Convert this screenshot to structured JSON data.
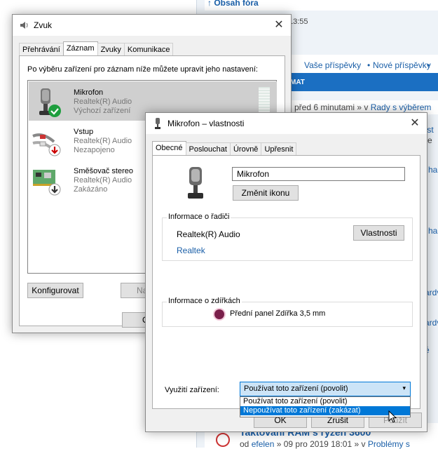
{
  "forum": {
    "header": "Obsah fóra",
    "time_fragment": "13:55",
    "link_posts": "Vaše příspěvky",
    "link_new": "Nové příspěvky",
    "bar_fragment": "MAT",
    "row1_time": "před 6 minutami » v ",
    "row1_link": "Rady s výběrem",
    "frag_1": "nist",
    "frag_2": "nte",
    "frag_3": "ha",
    "frag_4": "ha",
    "frag_5": "ardv",
    "frag_6": "ardv",
    "frag_7": "é",
    "post_title": "Taktování RAM s ryzen 3600",
    "post_meta_prefix": "od ",
    "post_author": "efelen",
    "post_meta_date": " » 09 pro 2019 18:01 » v ",
    "post_category": "Problémy s"
  },
  "sound": {
    "title": "Zvuk",
    "tabs": [
      "Přehrávání",
      "Záznam",
      "Zvuky",
      "Komunikace"
    ],
    "instruction": "Po výběru zařízení pro záznam níže můžete upravit jeho nastavení:",
    "devices": [
      {
        "name": "Mikrofon",
        "driver": "Realtek(R) Audio",
        "status": "Výchozí zařízení"
      },
      {
        "name": "Vstup",
        "driver": "Realtek(R) Audio",
        "status": "Nezapojeno"
      },
      {
        "name": "Směšovač stereo",
        "driver": "Realtek(R) Audio",
        "status": "Zakázáno"
      }
    ],
    "configure_label": "Konfigurovat",
    "default_partial": "Na",
    "ok_partial": "O"
  },
  "props": {
    "title": "Mikrofon – vlastnosti",
    "tabs": [
      "Obecné",
      "Poslouchat",
      "Úrovně",
      "Upřesnit"
    ],
    "name_value": "Mikrofon",
    "change_icon_label": "Změnit ikonu",
    "controller_group": "Informace o řadiči",
    "controller_name": "Realtek(R) Audio",
    "properties_label": "Vlastnosti",
    "controller_link": "Realtek",
    "jack_group": "Informace o zdířkách",
    "jack_name": "Přední panel Zdířka 3,5 mm",
    "usage_label": "Využití zařízení:",
    "usage_selected": "Používat toto zařízení (povolit)",
    "usage_options": [
      "Používat toto zařízení (povolit)",
      "Nepoužívat toto zařízení (zakázat)"
    ],
    "ok_label": "OK",
    "cancel_label": "Zrušit",
    "apply_label": "Použít"
  },
  "colors": {
    "accent": "#0078d7",
    "forum_blue": "#1b6fc2",
    "link": "#1a5fa8"
  }
}
